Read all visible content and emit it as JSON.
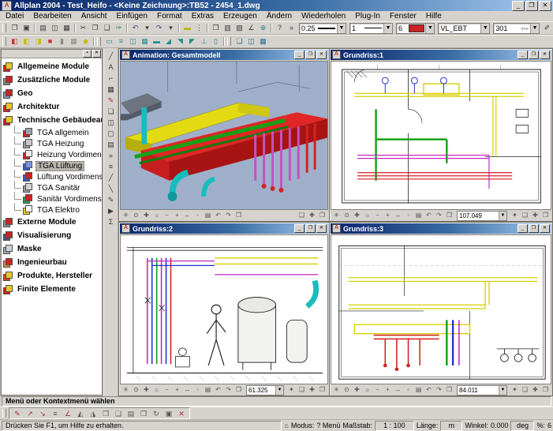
{
  "window": {
    "title": "Allplan 2004 - Test_Heifo - <Keine Zeichnung>:TB52 - 2454_1.dwg",
    "icon_glyph": "A",
    "min": "_",
    "max": "❐",
    "close": "✕"
  },
  "menu": {
    "items": [
      {
        "name": "menu-datei",
        "label": "Datei"
      },
      {
        "name": "menu-bearbeiten",
        "label": "Bearbeiten"
      },
      {
        "name": "menu-ansicht",
        "label": "Ansicht"
      },
      {
        "name": "menu-einfuegen",
        "label": "Einfügen"
      },
      {
        "name": "menu-format",
        "label": "Format"
      },
      {
        "name": "menu-extras",
        "label": "Extras"
      },
      {
        "name": "menu-erzeugen",
        "label": "Erzeugen"
      },
      {
        "name": "menu-aendern",
        "label": "Ändern"
      },
      {
        "name": "menu-wiederholen",
        "label": "Wiederholen"
      },
      {
        "name": "menu-plugin",
        "label": "Plug-In"
      },
      {
        "name": "menu-fenster",
        "label": "Fenster"
      },
      {
        "name": "menu-hilfe",
        "label": "Hilfe"
      }
    ]
  },
  "toolbar1": {
    "g0": [
      {
        "name": "open-icon",
        "g": "❒"
      },
      {
        "name": "save-icon",
        "g": "▣"
      }
    ],
    "g1": [
      {
        "name": "print-icon",
        "g": "▤"
      },
      {
        "name": "print-preview-icon",
        "g": "◫"
      },
      {
        "name": "screenshot-icon",
        "g": "▦"
      }
    ],
    "g2": [
      {
        "name": "cut-icon",
        "g": "✂"
      },
      {
        "name": "copy-icon",
        "g": "❐"
      },
      {
        "name": "paste-icon",
        "g": "❑"
      },
      {
        "name": "format-brush-icon",
        "g": "✑",
        "s": "color:#2a7d2a"
      }
    ],
    "g3": [
      {
        "name": "undo-icon",
        "g": "↶",
        "s": "color:#334d99"
      },
      {
        "name": "undo-dropdown-icon",
        "g": "▾"
      },
      {
        "name": "redo-icon",
        "g": "↷",
        "s": "color:#334d99"
      },
      {
        "name": "redo-dropdown-icon",
        "g": "▾"
      }
    ],
    "g4": [
      {
        "name": "line-icon",
        "g": "▬",
        "s": "color:#b8b410"
      },
      {
        "name": "point-snap-icon",
        "g": "⋮"
      }
    ],
    "g5": [
      {
        "name": "project-open-icon",
        "g": "❒"
      },
      {
        "name": "save-copy-icon",
        "g": "▥"
      },
      {
        "name": "image-icon",
        "g": "▧"
      },
      {
        "name": "measure-icon",
        "g": "∠"
      },
      {
        "name": "3d-view-icon",
        "g": "⊕",
        "s": "color:#2a7d7d"
      }
    ],
    "g6": [
      {
        "name": "context-help-icon",
        "g": "?"
      },
      {
        "name": "overflow-icon",
        "g": "»"
      }
    ],
    "pen_width": "0.25",
    "line_style": "1",
    "pen_color": "6",
    "pen_color_hex": "#cc2222",
    "layer": "VL_EBT",
    "segment": "301",
    "segment_pattern": "◦◦◦",
    "edit_pen_glyph": "✐"
  },
  "toolbar2": {
    "gA": [
      {
        "name": "duct-tool-icon",
        "g": "◧",
        "s": "color:#cc3333"
      },
      {
        "name": "fitting-tool-icon",
        "g": "◧",
        "s": "color:#c8ba00"
      },
      {
        "name": "transition-tool-icon",
        "g": "◨",
        "s": "color:#c8ba00"
      },
      {
        "name": "duct-part-icon",
        "g": "■",
        "s": "color:#cc3333"
      },
      {
        "name": "riser-icon",
        "g": "▮",
        "s": "color:#8a8a8a"
      },
      {
        "name": "grille-icon",
        "g": "▦",
        "s": "color:#8a8a8a"
      },
      {
        "name": "flex-duct-icon",
        "g": "◆",
        "s": "color:#c8ba00"
      }
    ],
    "gB": [
      {
        "name": "duct-run-icon",
        "g": "▭",
        "s": "color:#1f8f8f"
      },
      {
        "name": "duct-lines-icon",
        "g": "≡",
        "s": "color:#1f8f8f"
      },
      {
        "name": "duct-double-icon",
        "g": "◫",
        "s": "color:#1f8f8f"
      },
      {
        "name": "duct-grid-icon",
        "g": "▦",
        "s": "color:#1f8f8f"
      },
      {
        "name": "duct-solid-icon",
        "g": "▬",
        "s": "color:#1f8f8f"
      },
      {
        "name": "bend-icon",
        "g": "◢",
        "s": "color:#1f8f8f"
      },
      {
        "name": "branch-icon",
        "g": "◥",
        "s": "color:#1f8f8f"
      },
      {
        "name": "elbow-icon",
        "g": "◤",
        "s": "color:#1f8f8f"
      },
      {
        "name": "tee-icon",
        "g": "⊥",
        "s": "color:#1f8f8f"
      },
      {
        "name": "end-cap-icon",
        "g": "▯",
        "s": "color:#1f8f8f"
      }
    ],
    "gC": [
      {
        "name": "window-cascade-icon",
        "g": "❏",
        "s": "color:#2a6a8f"
      },
      {
        "name": "window-tile-icon",
        "g": "◫",
        "s": "color:#2a6a8f"
      },
      {
        "name": "window-new-icon",
        "g": "▦",
        "s": "color:#2a6a8f"
      }
    ]
  },
  "vtoolbar": {
    "icons": [
      {
        "name": "line-draw-icon",
        "g": "╱"
      },
      {
        "name": "text-icon",
        "g": "A"
      },
      {
        "name": "dimension-icon",
        "g": "⌐"
      },
      {
        "name": "hatch-icon",
        "g": "▦"
      },
      {
        "name": "red-pen-icon",
        "g": "✎",
        "s": "color:#b03030"
      },
      {
        "name": "layout-icon",
        "g": "❏"
      },
      {
        "name": "monitor-icon",
        "g": "◫"
      },
      {
        "name": "box-icon",
        "g": "▢"
      },
      {
        "name": "list-icon",
        "g": "▤"
      },
      {
        "name": "more-icon",
        "g": "»"
      },
      {
        "name": "lines-icon",
        "g": "≡"
      },
      {
        "name": "diagonal-icon",
        "g": "╱"
      },
      {
        "name": "backslash-icon",
        "g": "╲"
      },
      {
        "name": "pen-icon",
        "g": "✎"
      },
      {
        "name": "pointer-icon",
        "g": "▶"
      },
      {
        "name": "sum-icon",
        "g": "Σ"
      }
    ]
  },
  "sidebar": {
    "items": [
      {
        "name": "sidebar-item-allgemeine-module",
        "label": "Allgemeine Module",
        "cls": "top",
        "s1": "background:#cc2222",
        "s2": "background:#e8c822"
      },
      {
        "name": "sidebar-item-zusaetzliche-module",
        "label": "Zusätzliche Module",
        "cls": "top",
        "s1": "background:#8a8a8a",
        "s2": "background:#cc2222"
      },
      {
        "name": "sidebar-item-geo",
        "label": "Geo",
        "cls": "top",
        "s1": "background:#7f94aa",
        "s2": "background:#cc2222"
      },
      {
        "name": "sidebar-item-architektur",
        "label": "Architektur",
        "cls": "top",
        "s1": "background:#cc2222",
        "s2": "background:#e8c822"
      },
      {
        "name": "sidebar-item-tga",
        "label": "Technische Gebäudeausrüstung",
        "cls": "top",
        "s1": "background:#cc2222",
        "s2": "background:#e8c822"
      },
      {
        "name": "sidebar-item-tga-allgemein",
        "label": "TGA allgemein",
        "cls": "child",
        "s1": "background:#cc2222",
        "s2": "background:#9aa4aa"
      },
      {
        "name": "sidebar-item-tga-heizung",
        "label": "TGA Heizung",
        "cls": "child",
        "s1": "background:#9a9a9a",
        "s2": "background:#c8c8c8"
      },
      {
        "name": "sidebar-item-heizung-vordimensionierung",
        "label": "Heizung Vordimensionierung",
        "cls": "child",
        "s1": "background:#cc2222",
        "s2": "background:#eeeeee"
      },
      {
        "name": "sidebar-item-tga-lueftung",
        "label": "TGA Lüftung",
        "cls": "child sel",
        "s1": "background:#3a5ccc",
        "s2": "background:#7a93e0"
      },
      {
        "name": "sidebar-item-lueftung-vordimensionierung",
        "label": "Lüftung Vordimensionierung",
        "cls": "child",
        "s1": "background:#3a5ccc",
        "s2": "background:#cc2222"
      },
      {
        "name": "sidebar-item-tga-sanitaer",
        "label": "TGA Sanitär",
        "cls": "child",
        "s1": "background:#9a9a9a",
        "s2": "background:#d5d5d5"
      },
      {
        "name": "sidebar-item-sanitaer-vordimensionierung",
        "label": "Sanitär Vordimensionierung",
        "cls": "child",
        "s1": "background:#2a9a44",
        "s2": "background:#cc2222"
      },
      {
        "name": "sidebar-item-tga-elektro",
        "label": "TGA Elektro",
        "cls": "child",
        "s1": "background:#e8c822",
        "s2": "background:#ffffff"
      },
      {
        "name": "sidebar-item-externe-module",
        "label": "Externe Module",
        "cls": "top",
        "s1": "background:#8a8a8a",
        "s2": "background:#cc2222"
      },
      {
        "name": "sidebar-item-visualisierung",
        "label": "Visualisierung",
        "cls": "top",
        "s1": "background:#445577",
        "s2": "background:#cc2222"
      },
      {
        "name": "sidebar-item-maske",
        "label": "Maske",
        "cls": "top",
        "s1": "background:#99a2aa",
        "s2": "background:#ccd2d8"
      },
      {
        "name": "sidebar-item-ingenieurbau",
        "label": "Ingenieurbau",
        "cls": "top",
        "s1": "background:#cc8844",
        "s2": "background:#cc2222"
      },
      {
        "name": "sidebar-item-produkte-hersteller",
        "label": "Produkte, Hersteller",
        "cls": "top",
        "s1": "background:#cc4422",
        "s2": "background:#e8c822"
      },
      {
        "name": "sidebar-item-finite-elemente",
        "label": "Finite Elemente",
        "cls": "top",
        "s1": "background:#cc2222",
        "s2": "background:#e8c822"
      }
    ],
    "head_pin": "▪",
    "head_close": "✕"
  },
  "viewports": [
    {
      "name": "viewport-animation",
      "title": "Animation: Gesamtmodell"
    },
    {
      "name": "viewport-grundriss-1",
      "title": "Grundriss:1",
      "value": "107.049"
    },
    {
      "name": "viewport-grundriss-2",
      "title": "Grundriss:2",
      "value": "61.325"
    },
    {
      "name": "viewport-grundriss-3",
      "title": "Grundriss:3",
      "value": "84.011"
    }
  ],
  "vpbar": {
    "icons": [
      {
        "name": "zoom-all-icon",
        "g": "✳"
      },
      {
        "name": "zoom-section-icon",
        "g": "⊙"
      },
      {
        "name": "pan-icon",
        "g": "✚"
      },
      {
        "name": "regen-icon",
        "g": "☼"
      },
      {
        "name": "zoom-out-icon",
        "g": "−"
      },
      {
        "name": "zoom-in-icon",
        "g": "+"
      },
      {
        "name": "pan-horizontal-icon",
        "g": "↔"
      },
      {
        "name": "previous-view-icon",
        "g": "◦"
      },
      {
        "name": "print-view-icon",
        "g": "▤"
      },
      {
        "name": "view-undo-icon",
        "g": "↶"
      },
      {
        "name": "view-redo-icon",
        "g": "↷"
      },
      {
        "name": "save-view-icon",
        "g": "❒"
      }
    ],
    "pin": {
      "name": "pin-icon",
      "g": "✦"
    },
    "right": [
      {
        "name": "window-cascade-icon",
        "g": "❏"
      },
      {
        "name": "window-split-icon",
        "g": "✚"
      },
      {
        "name": "window-copy-icon",
        "g": "❐"
      }
    ]
  },
  "prompt": {
    "text": "Menü oder Kontextmenü wählen"
  },
  "redrow": {
    "icons": [
      {
        "name": "correction-pen-icon",
        "g": "✎",
        "s": "color:#a33333"
      },
      {
        "name": "point-modify-icon",
        "g": "↗",
        "s": "color:#a33333"
      },
      {
        "name": "point-delete-icon",
        "g": "↘",
        "s": "color:#a33333"
      },
      {
        "name": "parallel-icon",
        "g": "≡",
        "s": "color:#555555"
      },
      {
        "name": "angle-icon",
        "g": "∠",
        "s": "color:#a33333"
      },
      {
        "name": "mirror-left-icon",
        "g": "◭",
        "s": "color:#555555"
      },
      {
        "name": "mirror-right-icon",
        "g": "◮",
        "s": "color:#555555"
      },
      {
        "name": "copy-elements-icon",
        "g": "❐",
        "s": "color:#555555"
      },
      {
        "name": "move-elements-icon",
        "g": "❑",
        "s": "color:#555555"
      },
      {
        "name": "stamp-icon",
        "g": "▤",
        "s": "color:#555555"
      },
      {
        "name": "duplicate-icon",
        "g": "❒",
        "s": "color:#555555"
      },
      {
        "name": "rotate-icon",
        "g": "↻",
        "s": "color:#555555"
      },
      {
        "name": "scale-icon",
        "g": "▣",
        "s": "color:#555555"
      },
      {
        "name": "delete-icon",
        "g": "✕",
        "s": "color:#cc2222"
      }
    ]
  },
  "statusbar": {
    "help": "Drücken Sie F1, um Hilfe zu erhalten.",
    "icon_glyph": "⌂",
    "modus_label": "Modus:",
    "modus_value": "? Menü",
    "massstab_label": "Maßstab:",
    "massstab_value": "1 : 100",
    "laenge_label": "Länge:",
    "laenge_value": "m",
    "winkel_label": "Winkel:",
    "winkel_value": "0.000",
    "unit": "deg",
    "percent_label": "%:",
    "percent_value": "6"
  }
}
